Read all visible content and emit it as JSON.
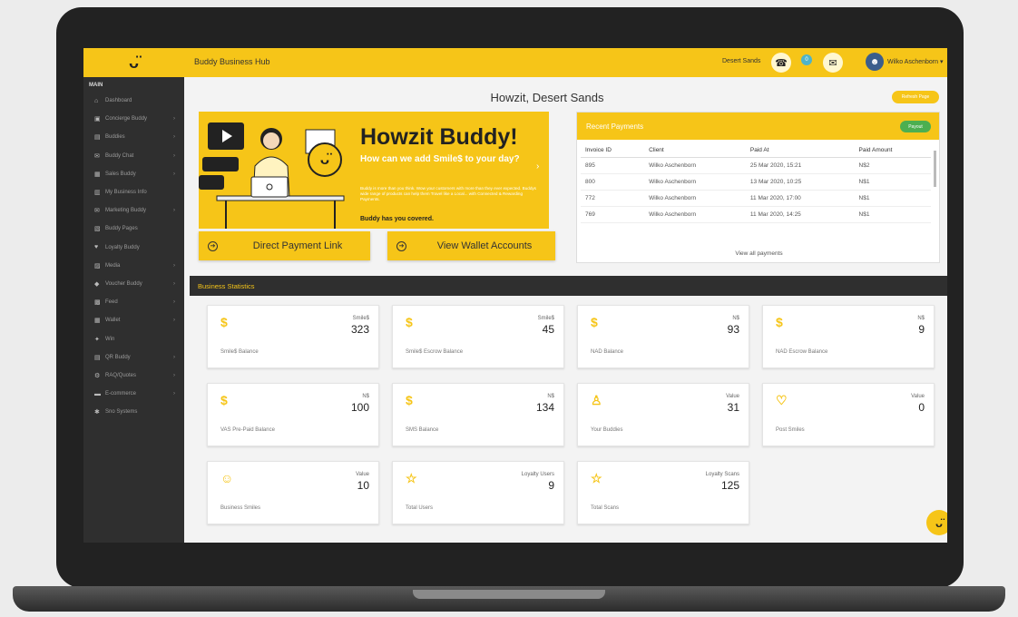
{
  "app": {
    "logo": "ᴗ̈",
    "title": "Buddy Business Hub",
    "store": "Desert Sands",
    "user": "Wilko Aschenborn ▾"
  },
  "sidebar": {
    "heading": "MAIN",
    "items": [
      {
        "icon": "⌂",
        "label": "Dashboard",
        "chevron": ""
      },
      {
        "icon": "▣",
        "label": "Concierge Buddy",
        "chevron": "›"
      },
      {
        "icon": "▤",
        "label": "Buddies",
        "chevron": "›"
      },
      {
        "icon": "✉",
        "label": "Buddy Chat",
        "chevron": "›"
      },
      {
        "icon": "▦",
        "label": "Sales Buddy",
        "chevron": "›"
      },
      {
        "icon": "▥",
        "label": "My Business Info",
        "chevron": ""
      },
      {
        "icon": "✉",
        "label": "Marketing Buddy",
        "chevron": "›"
      },
      {
        "icon": "▧",
        "label": "Buddy Pages",
        "chevron": ""
      },
      {
        "icon": "♥",
        "label": "Loyalty Buddy",
        "chevron": ""
      },
      {
        "icon": "▨",
        "label": "Media",
        "chevron": "›"
      },
      {
        "icon": "◆",
        "label": "Voucher Buddy",
        "chevron": "›"
      },
      {
        "icon": "▩",
        "label": "Feed",
        "chevron": "›"
      },
      {
        "icon": "▦",
        "label": "Wallet",
        "chevron": "›"
      },
      {
        "icon": "✦",
        "label": "Win",
        "chevron": ""
      },
      {
        "icon": "▤",
        "label": "QR Buddy",
        "chevron": "›"
      },
      {
        "icon": "⚙",
        "label": "RAQ/Quotes",
        "chevron": "›"
      },
      {
        "icon": "▬",
        "label": "E-commerce",
        "chevron": "›"
      },
      {
        "icon": "✱",
        "label": "Sno Systems",
        "chevron": ""
      }
    ]
  },
  "main": {
    "greeting": "Howzit, Desert Sands",
    "refresh_label": "Refresh Page",
    "banner": {
      "title": "Howzit Buddy!",
      "subtitle": "How can we add Smile$ to your day?",
      "small_text": "Buddy is more than you think. Wow your customers with more than they ever expected. Buddys wide range of products can help them Travel like a Local... with Connected & Rewarding Payments.",
      "strong_text": "Buddy has you covered."
    },
    "cta_direct": "Direct Payment Link",
    "cta_wallet": "View Wallet Accounts"
  },
  "payments": {
    "title": "Recent Payments",
    "payout_label": "Payout",
    "columns": [
      "Invoice ID",
      "Client",
      "Paid At",
      "Paid Amount"
    ],
    "rows": [
      [
        "895",
        "Wilko Aschenborn",
        "25 Mar 2020, 15:21",
        "N$2"
      ],
      [
        "800",
        "Wilko Aschenborn",
        "13 Mar 2020, 10:25",
        "N$1"
      ],
      [
        "772",
        "Wilko Aschenborn",
        "11 Mar 2020, 17:00",
        "N$1"
      ],
      [
        "769",
        "Wilko Aschenborn",
        "11 Mar 2020, 14:25",
        "N$1"
      ]
    ],
    "view_all": "View all payments"
  },
  "stats": {
    "title": "Business Statistics",
    "cards": [
      {
        "icon": "$",
        "unit": "Smile$",
        "value": "323",
        "label": "Smile$ Balance"
      },
      {
        "icon": "$",
        "unit": "Smile$",
        "value": "45",
        "label": "Smile$ Escrow Balance"
      },
      {
        "icon": "$",
        "unit": "N$",
        "value": "93",
        "label": "NAD Balance"
      },
      {
        "icon": "$",
        "unit": "N$",
        "value": "9",
        "label": "NAD Escrow Balance"
      },
      {
        "icon": "$",
        "unit": "N$",
        "value": "100",
        "label": "VAS Pre-Paid Balance"
      },
      {
        "icon": "$",
        "unit": "N$",
        "value": "134",
        "label": "SMS Balance"
      },
      {
        "icon": "♙",
        "unit": "Value",
        "value": "31",
        "label": "Your Buddies"
      },
      {
        "icon": "♡",
        "unit": "Value",
        "value": "0",
        "label": "Post Smiles"
      },
      {
        "icon": "☺",
        "unit": "Value",
        "value": "10",
        "label": "Business Smiles"
      },
      {
        "icon": "☆",
        "unit": "Loyalty Users",
        "value": "9",
        "label": "Total Users"
      },
      {
        "icon": "☆",
        "unit": "Loyalty Scans",
        "value": "125",
        "label": "Total Scans"
      }
    ]
  },
  "colors": {
    "brand": "#f6c518",
    "sidebar": "#2f2f2f",
    "payout": "#4caf50"
  },
  "icons": [
    "smiley-logo-icon",
    "support-icon",
    "status-dot-icon",
    "chat-icon",
    "user-avatar-icon",
    "helper-chat-icon"
  ]
}
